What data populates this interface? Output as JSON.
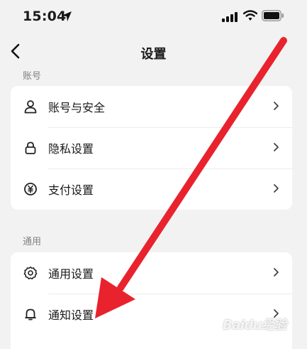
{
  "status_bar": {
    "time": "15:04",
    "icons": [
      "location-arrow-icon",
      "signal-icon",
      "wifi-icon",
      "battery-icon"
    ]
  },
  "nav": {
    "back_icon": "chevron-left-icon",
    "title": "设置"
  },
  "sections": [
    {
      "label": "账号",
      "items": [
        {
          "label": "账号与安全",
          "icon": "person-icon"
        },
        {
          "label": "隐私设置",
          "icon": "lock-icon"
        },
        {
          "label": "支付设置",
          "icon": "yuan-icon"
        }
      ]
    },
    {
      "label": "通用",
      "items": [
        {
          "label": "通用设置",
          "icon": "gear-icon"
        },
        {
          "label": "通知设置",
          "icon": "bell-icon"
        }
      ]
    }
  ],
  "annotation": {
    "arrow_color": "#e8232e"
  },
  "watermark": {
    "text": "Baidu经验"
  },
  "colors": {
    "background": "#f2f2f2",
    "card": "#ffffff",
    "section_label": "#808080"
  }
}
